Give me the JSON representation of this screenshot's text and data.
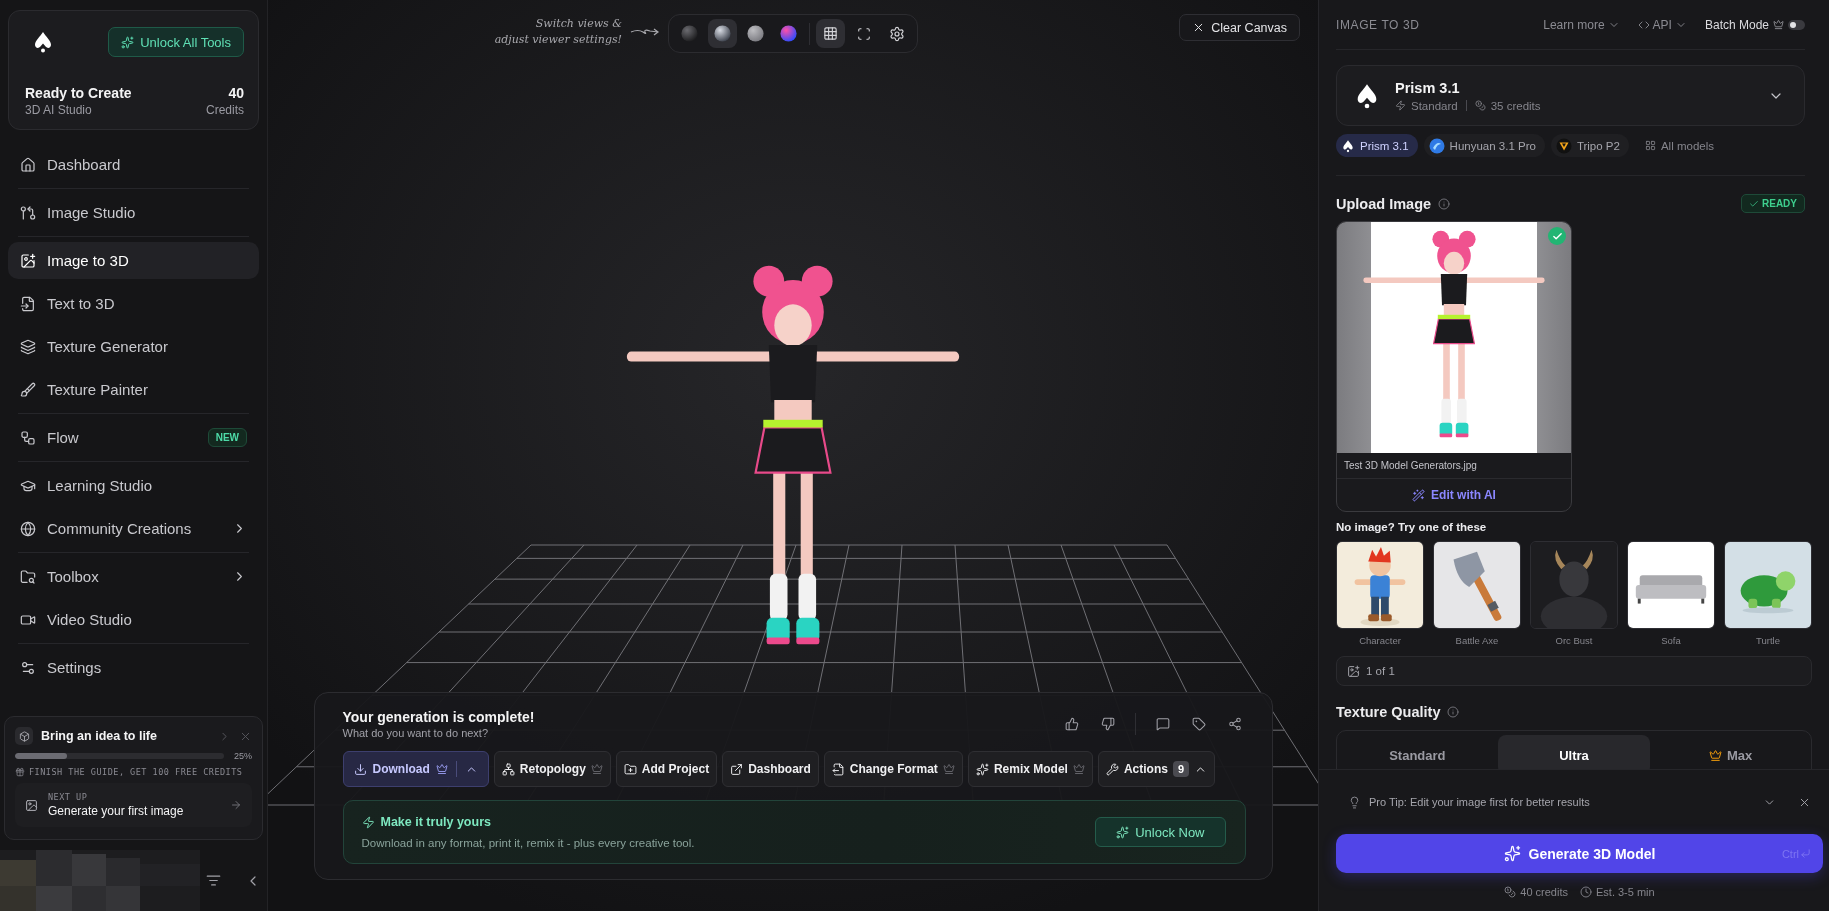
{
  "sidebar": {
    "brand": {
      "button": "Unlock All Tools",
      "title": "Ready to Create",
      "subtitle": "3D AI Studio",
      "credits": "40",
      "credits_label": "Credits"
    },
    "sections": [
      {
        "items": [
          {
            "label": "Dashboard",
            "selected": false,
            "chevron": false
          }
        ]
      },
      {
        "items": [
          {
            "label": "Image Studio",
            "selected": false,
            "chevron": false
          }
        ]
      },
      {
        "items": [
          {
            "label": "Image to 3D",
            "selected": true,
            "chevron": false
          },
          {
            "label": "Text to 3D",
            "selected": false,
            "chevron": false
          },
          {
            "label": "Texture Generator",
            "selected": false,
            "chevron": false
          },
          {
            "label": "Texture Painter",
            "selected": false,
            "chevron": false
          }
        ]
      },
      {
        "items": [
          {
            "label": "Flow",
            "selected": false,
            "chevron": false,
            "badge": "NEW"
          }
        ]
      },
      {
        "items": [
          {
            "label": "Learning Studio",
            "selected": false,
            "chevron": false
          },
          {
            "label": "Community Creations",
            "selected": false,
            "chevron": true
          }
        ]
      },
      {
        "items": [
          {
            "label": "Toolbox",
            "selected": false,
            "chevron": true
          },
          {
            "label": "Video Studio",
            "selected": false,
            "chevron": false
          }
        ]
      },
      {
        "items": [
          {
            "label": "Settings",
            "selected": false,
            "chevron": false
          }
        ]
      }
    ],
    "guide": {
      "title": "Bring an idea to life",
      "level": 0.25,
      "percent": "25%",
      "note": "FINISH THE GUIDE, GET 100 FREE CREDITS",
      "next_label": "NEXT UP",
      "next_title": "Generate your first image"
    }
  },
  "viewer": {
    "hint": [
      "Switch views &",
      "adjust viewer settings!"
    ],
    "view_modes": [
      {
        "selected": false
      },
      {
        "selected": true
      },
      {
        "selected": false
      },
      {
        "selected": false
      }
    ],
    "grid": {
      "on": true
    },
    "clear_button": "Clear Canvas"
  },
  "result_panel": {
    "title": "Your generation is complete!",
    "subtitle": "What do you want to do next?",
    "actions": [
      {
        "label": "Download",
        "primary": true,
        "premium": true,
        "menu": true
      },
      {
        "label": "Retopology",
        "primary": false,
        "premium": true,
        "menu": false
      },
      {
        "label": "Add Project",
        "primary": false,
        "premium": false,
        "menu": false
      },
      {
        "label": "Dashboard",
        "primary": false,
        "premium": false,
        "menu": false
      },
      {
        "label": "Change Format",
        "primary": false,
        "premium": true,
        "menu": false
      },
      {
        "label": "Remix Model",
        "primary": false,
        "premium": true,
        "menu": false
      },
      {
        "label": "Actions",
        "primary": false,
        "premium": false,
        "menu": true,
        "count": "9"
      }
    ],
    "promo": {
      "title": "Make it truly yours",
      "text": "Download in any format, print it, remix it - plus every creative tool.",
      "button": "Unlock Now"
    }
  },
  "panel": {
    "title": "IMAGE TO 3D",
    "learn_more": "Learn more",
    "api": "API",
    "batch_mode": {
      "label": "Batch Mode",
      "on": false
    },
    "model": {
      "name": "Prism 3.1",
      "tier": "Standard",
      "credits": "35 credits"
    },
    "model_chips": [
      {
        "label": "Prism 3.1",
        "selected": true
      },
      {
        "label": "Hunyuan 3.1 Pro",
        "selected": false
      },
      {
        "label": "Tripo P2",
        "selected": false
      }
    ],
    "all_models": "All models",
    "upload": {
      "title": "Upload Image",
      "status": "READY",
      "file_name": "Test 3D Model Generators.jpg",
      "edit_button": "Edit with AI"
    },
    "samples_title": "No image? Try one of these",
    "samples": [
      {
        "label": "Character"
      },
      {
        "label": "Battle Axe"
      },
      {
        "label": "Orc Bust"
      },
      {
        "label": "Sofa"
      },
      {
        "label": "Turtle"
      }
    ],
    "counter": "1 of 1",
    "texture_quality": {
      "title": "Texture Quality",
      "options": [
        {
          "label": "Standard",
          "selected": false,
          "premium": false
        },
        {
          "label": "Ultra",
          "selected": true,
          "premium": false
        },
        {
          "label": "Max",
          "selected": false,
          "premium": true
        }
      ]
    },
    "tip": "Pro Tip: Edit your image first for better results",
    "generate": {
      "label": "Generate 3D Model",
      "shortcut": "Ctrl"
    },
    "cost": "40 credits",
    "estimate": "Est. 3-5 min"
  }
}
